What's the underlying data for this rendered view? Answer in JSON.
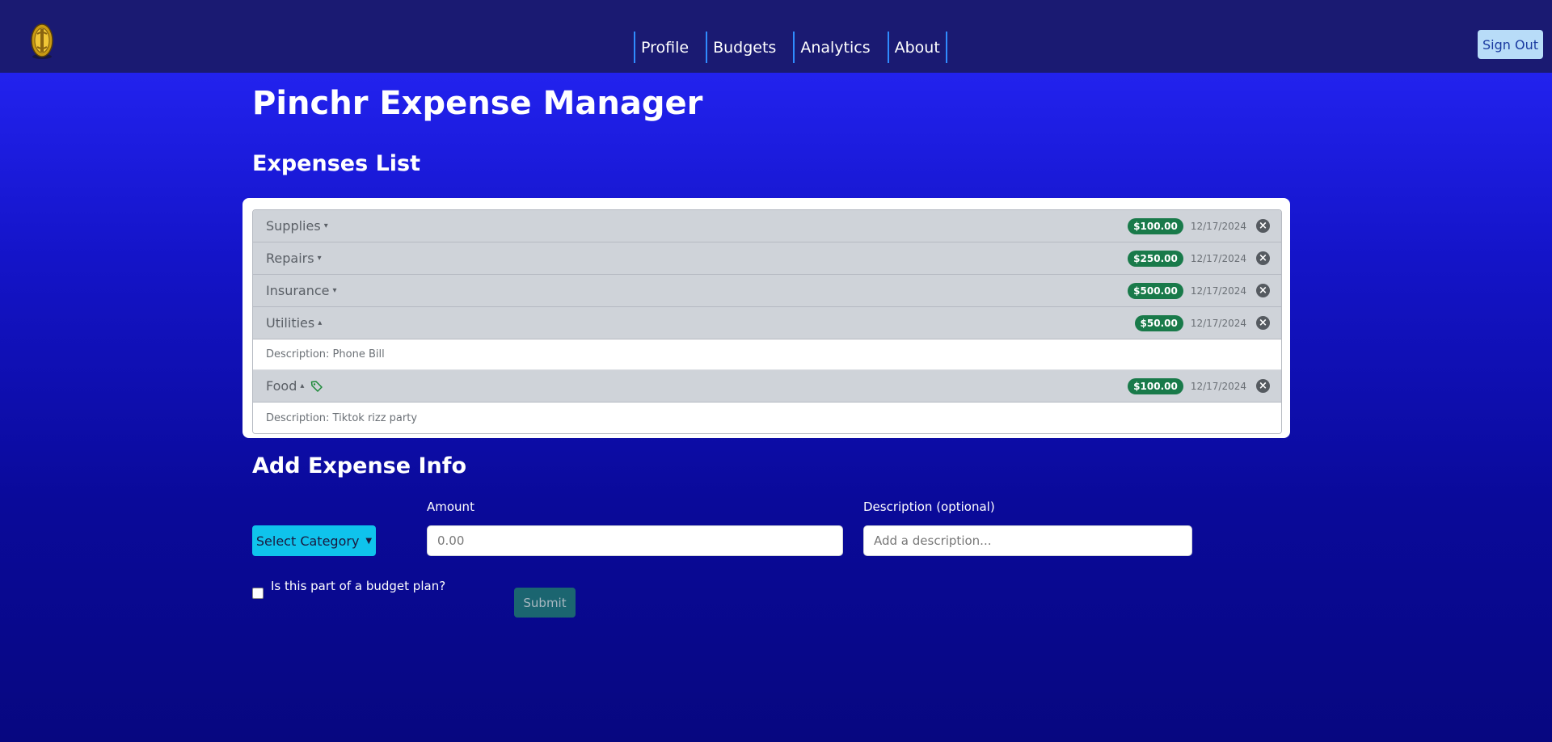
{
  "nav": {
    "links": [
      "Profile",
      "Budgets",
      "Analytics",
      "About"
    ],
    "sign_out": "Sign Out"
  },
  "page": {
    "title": "Pinchr Expense Manager",
    "list_title": "Expenses List"
  },
  "expenses": [
    {
      "category": "Supplies",
      "caret": "▾",
      "amount": "$100.00",
      "date": "12/17/2024"
    },
    {
      "category": "Repairs",
      "caret": "▾",
      "amount": "$250.00",
      "date": "12/17/2024"
    },
    {
      "category": "Insurance",
      "caret": "▾",
      "amount": "$500.00",
      "date": "12/17/2024"
    },
    {
      "category": "Utilities",
      "caret": "▴",
      "amount": "$50.00",
      "date": "12/17/2024",
      "description": "Description: Phone Bill"
    },
    {
      "category": "Food",
      "caret": "▴",
      "amount": "$100.00",
      "date": "12/17/2024",
      "description": "Description: Tiktok rizz party",
      "budget_tag": true
    }
  ],
  "form": {
    "title": "Add Expense Info",
    "select_category": "Select Category",
    "amount_label": "Amount",
    "amount_placeholder": "0.00",
    "description_label": "Description (optional)",
    "description_placeholder": "Add a description...",
    "budget_checkbox_label": "Is this part of a budget plan?",
    "submit": "Submit"
  },
  "colors": {
    "nav_bg": "#1a1a72",
    "badge": "#197a4a",
    "select_button": "#0fc3ec",
    "submit_button": "#1b6570"
  }
}
